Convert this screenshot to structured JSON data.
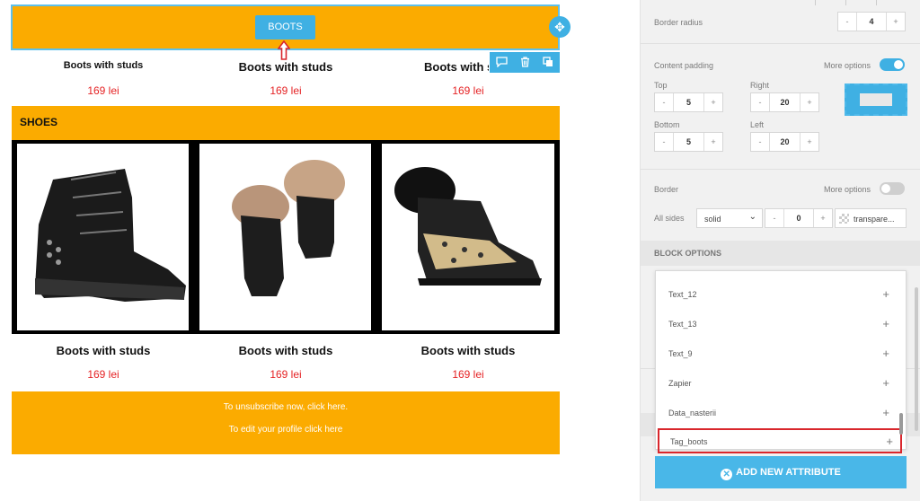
{
  "email": {
    "boots_button": "BOOTS",
    "toolbar_icons": [
      "comment-icon",
      "trash-icon",
      "copy-icon"
    ],
    "top_products": [
      {
        "name": "Boots with studs",
        "price": "169 lei"
      },
      {
        "name": "Boots with studs",
        "price": "169 lei"
      },
      {
        "name": "Boots with s",
        "price": "169 lei"
      }
    ],
    "section_title": "SHOES",
    "products": [
      {
        "name": "Boots with studs",
        "price": "169 lei",
        "image": "black-studded-boot"
      },
      {
        "name": "Boots with studs",
        "price": "169 lei",
        "image": "fur-boots"
      },
      {
        "name": "Boots with studs",
        "price": "169 lei",
        "image": "leopard-sneaker-boot"
      }
    ],
    "footer": {
      "unsubscribe": "To unsubscribe now, click here.",
      "edit_profile": "To edit your profile click here"
    },
    "colors": {
      "accent_orange": "#fbab00",
      "button_blue": "#3fb0e3",
      "price_red": "#e52325"
    }
  },
  "panel": {
    "border_radius": {
      "label": "Border radius",
      "minus": "-",
      "value": "4",
      "plus": "+"
    },
    "content_padding": {
      "label": "Content padding",
      "more_options": "More options",
      "more_options_on": true,
      "top": {
        "label": "Top",
        "value": "5"
      },
      "right": {
        "label": "Right",
        "value": "20"
      },
      "bottom": {
        "label": "Bottom",
        "value": "5"
      },
      "left": {
        "label": "Left",
        "value": "20"
      }
    },
    "border": {
      "label": "Border",
      "more_options": "More options",
      "more_options_on": false,
      "all_sides": "All sides",
      "style": "solid",
      "width": "0",
      "color": "transpare..."
    },
    "block_options": "BLOCK OPTIONS",
    "attributes": [
      "Text_12",
      "Text_13",
      "Text_9",
      "Zapier",
      "Data_nasterii",
      "Tag_boots"
    ],
    "add_attribute": "ADD NEW ATTRIBUTE",
    "colors": {
      "toggle_on": "#3fb0e3",
      "toggle_off": "#cfcfcf",
      "highlight_red": "#d9262c"
    }
  }
}
